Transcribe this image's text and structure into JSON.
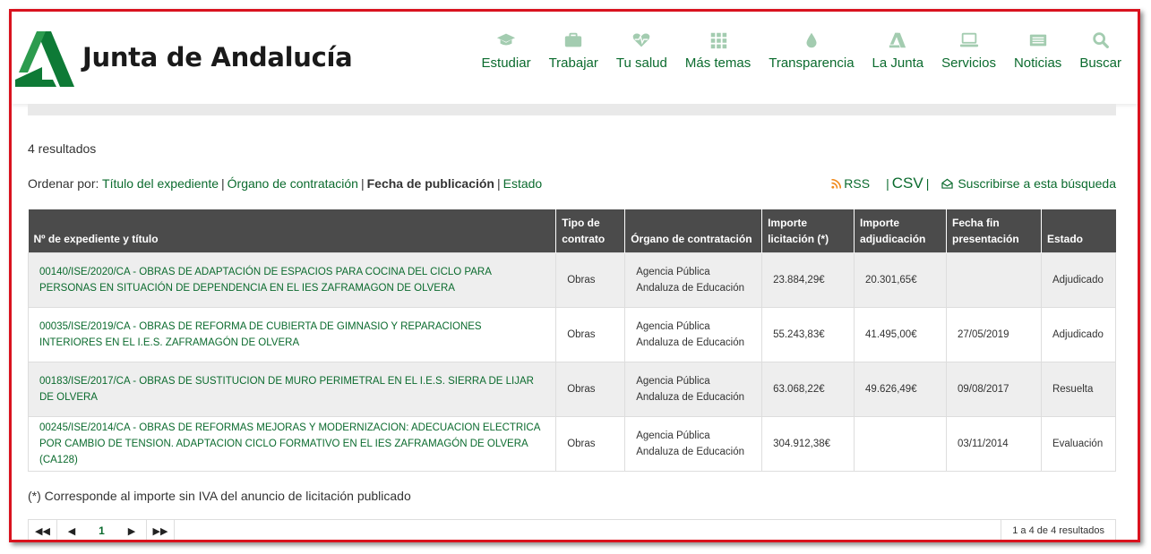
{
  "header": {
    "brand": "Junta de Andalucía",
    "nav": [
      {
        "label": "Estudiar",
        "icon": "graduation-cap-icon"
      },
      {
        "label": "Trabajar",
        "icon": "briefcase-icon"
      },
      {
        "label": "Tu salud",
        "icon": "heartbeat-icon"
      },
      {
        "label": "Más temas",
        "icon": "grid-icon"
      },
      {
        "label": "Transparencia",
        "icon": "drop-icon"
      },
      {
        "label": "La Junta",
        "icon": "junta-logo-icon"
      },
      {
        "label": "Servicios",
        "icon": "laptop-icon"
      },
      {
        "label": "Noticias",
        "icon": "newspaper-icon"
      },
      {
        "label": "Buscar",
        "icon": "search-icon"
      }
    ],
    "accent_color": "#0b6b2e"
  },
  "results": {
    "count_text": "4 resultados"
  },
  "sort": {
    "label": "Ordenar por:",
    "options": [
      "Título del expediente",
      "Órgano de contratación",
      "Fecha de publicación",
      "Estado"
    ],
    "active": "Fecha de publicación"
  },
  "tools": {
    "rss": "RSS",
    "csv": "CSV",
    "subscribe": "Suscribirse a esta búsqueda"
  },
  "table": {
    "headers": {
      "title": "Nº de expediente y título",
      "type": [
        "Tipo de",
        "contrato"
      ],
      "organ": "Órgano de contratación",
      "tender": [
        "Importe",
        "licitación (*)"
      ],
      "award": [
        "Importe",
        "adjudicación"
      ],
      "deadline": [
        "Fecha fin",
        "presentación"
      ],
      "status": "Estado"
    },
    "rows": [
      {
        "title": "00140/ISE/2020/CA - OBRAS DE ADAPTACIÓN DE ESPACIOS PARA COCINA DEL CICLO PARA PERSONAS EN SITUACIÓN DE DEPENDENCIA EN EL IES ZAFRAMAGON DE OLVERA",
        "type": "Obras",
        "organ": [
          "Agencia Pública",
          "Andaluza de Educación"
        ],
        "tender": "23.884,29€",
        "award": "20.301,65€",
        "deadline": "",
        "status": "Adjudicado"
      },
      {
        "title": "00035/ISE/2019/CA - OBRAS DE REFORMA DE CUBIERTA DE GIMNASIO Y REPARACIONES INTERIORES EN EL I.E.S. ZAFRAMAGÓN DE OLVERA",
        "type": "Obras",
        "organ": [
          "Agencia Pública",
          "Andaluza de Educación"
        ],
        "tender": "55.243,83€",
        "award": "41.495,00€",
        "deadline": "27/05/2019",
        "status": "Adjudicado"
      },
      {
        "title": "00183/ISE/2017/CA - OBRAS DE SUSTITUCION DE MURO PERIMETRAL EN EL I.E.S. SIERRA DE LIJAR DE OLVERA",
        "type": "Obras",
        "organ": [
          "Agencia Pública",
          "Andaluza de Educación"
        ],
        "tender": "63.068,22€",
        "award": "49.626,49€",
        "deadline": "09/08/2017",
        "status": "Resuelta"
      },
      {
        "title": "00245/ISE/2014/CA - OBRAS DE REFORMAS MEJORAS Y MODERNIZACION: ADECUACION ELECTRICA POR CAMBIO DE TENSION. ADAPTACION CICLO FORMATIVO EN EL IES ZAFRAMAGÓN DE OLVERA (CA128)",
        "type": "Obras",
        "organ": [
          "Agencia Pública",
          "Andaluza de Educación"
        ],
        "tender": "304.912,38€",
        "award": "",
        "deadline": "03/11/2014",
        "status": "Evaluación"
      }
    ]
  },
  "note": "(*) Corresponde al importe sin IVA del anuncio de licitación publicado",
  "pager": {
    "current_page": "1",
    "info": "1 a 4 de 4 resultados"
  }
}
